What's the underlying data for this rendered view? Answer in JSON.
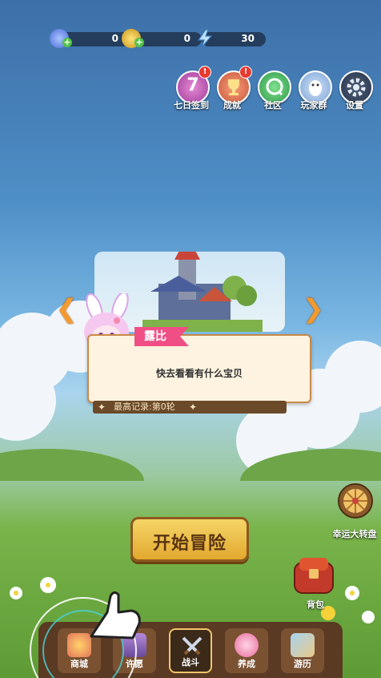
{
  "resources": [
    {
      "name": "gems",
      "value": "0",
      "icon": "gem-icon"
    },
    {
      "name": "coins",
      "value": "0",
      "icon": "coin-icon"
    },
    {
      "name": "energy",
      "value": "30",
      "icon": "lightning-icon"
    }
  ],
  "top_menu": [
    {
      "label": "七日签到",
      "icon": "seven-day-checkin-icon",
      "has_badge": true,
      "badge": "!"
    },
    {
      "label": "成就",
      "icon": "trophy-icon",
      "has_badge": true,
      "badge": "!"
    },
    {
      "label": "社区",
      "icon": "community-icon"
    },
    {
      "label": "玩家群",
      "icon": "penguin-icon"
    },
    {
      "label": "设置",
      "icon": "gear-icon"
    }
  ],
  "checkin_number": "7",
  "character": {
    "name": "露比"
  },
  "dialog": {
    "text": "快去看看有什么宝贝"
  },
  "record": {
    "text": "最高记录:第0轮"
  },
  "start_button": {
    "label": "开始冒险"
  },
  "side": {
    "wheel_label": "幸运大转盘",
    "bag_label": "背包"
  },
  "nav": [
    {
      "label": "商城",
      "icon": "shop-icon"
    },
    {
      "label": "许愿",
      "icon": "wish-icon"
    },
    {
      "label": "战斗",
      "icon": "swords-icon",
      "active": true
    },
    {
      "label": "养成",
      "icon": "paw-icon"
    },
    {
      "label": "游历",
      "icon": "map-icon"
    }
  ],
  "colors": {
    "accent": "#f2c46a",
    "nametag": "#f04f86",
    "badge": "#e83a2e"
  }
}
